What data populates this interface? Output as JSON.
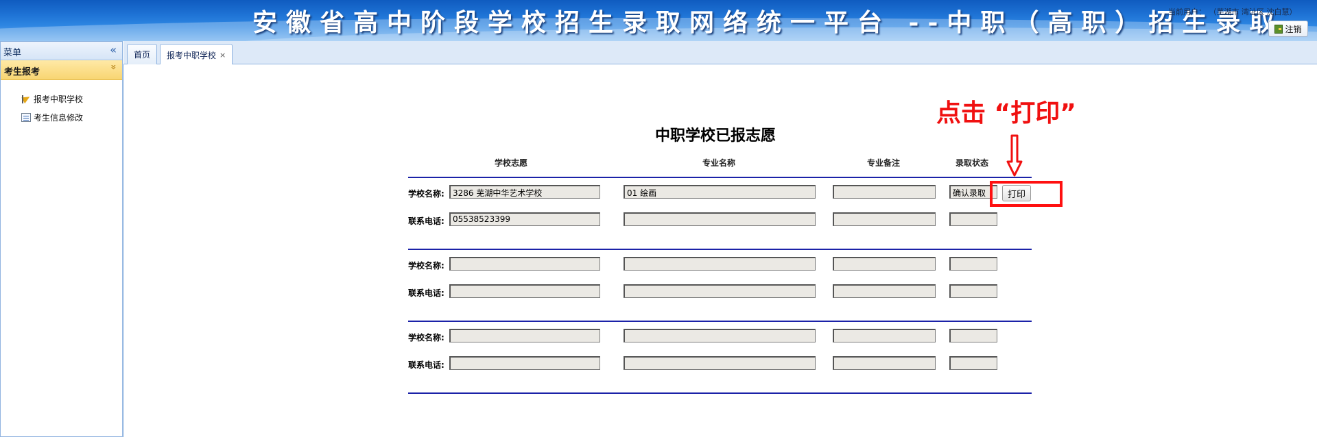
{
  "header": {
    "title": "安徽省高中阶段学校招生录取网络统一平台 --中职（高职）招生录取",
    "current_user_label": "当前用户：",
    "current_user_value": "（芜湖市 湾沚区 沈白慧）",
    "logout_label": "注销",
    "logout_icon": "exit-icon"
  },
  "sidebar": {
    "title": "菜单",
    "collapse_icon": "double-chevron-left-icon",
    "section_title": "考生报考",
    "section_icon": "double-chevron-up-icon",
    "items": [
      {
        "label": "报考中职学校",
        "icon": "flag-icon"
      },
      {
        "label": "考生信息修改",
        "icon": "form-icon"
      }
    ]
  },
  "tabs": [
    {
      "label": "首页",
      "closable": false
    },
    {
      "label": "报考中职学校",
      "closable": true,
      "close": "×"
    }
  ],
  "form": {
    "title": "中职学校已报志愿",
    "columns": [
      "学校志愿",
      "专业名称",
      "专业备注",
      "录取状态"
    ],
    "school_label": "学校名称:",
    "phone_label": "联系电话:",
    "groups": [
      {
        "school": "3286 芜湖中华艺术学校",
        "major": "01 绘画",
        "major_note": "",
        "status": "确认录取",
        "phone": "05538523399",
        "phone_major": "",
        "phone_note": "",
        "phone_status": ""
      },
      {
        "school": "",
        "major": "",
        "major_note": "",
        "status": "",
        "phone": "",
        "phone_major": "",
        "phone_note": "",
        "phone_status": ""
      },
      {
        "school": "",
        "major": "",
        "major_note": "",
        "status": "",
        "phone": "",
        "phone_major": "",
        "phone_note": "",
        "phone_status": ""
      }
    ],
    "print_label": "打印"
  },
  "annotation": {
    "text": "点击 “打印”",
    "color": "#f01010"
  }
}
